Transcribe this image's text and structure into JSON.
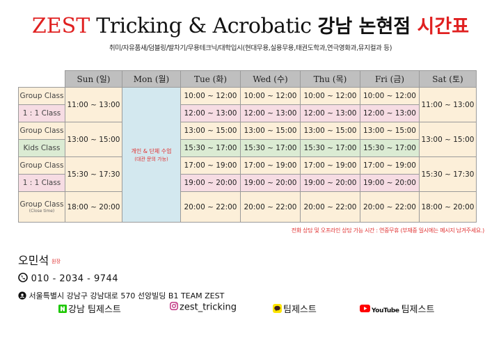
{
  "title": {
    "zest": "ZEST",
    "middle": " Tricking & Acrobatic ",
    "korean": "강남 논현점 ",
    "timetable": "시간표"
  },
  "subtitle": "취미/자유품새/덤블링/발차기/무용테크닉/대학입시(현대무용,실용무용,태권도학과,연극영화과,뮤지컬과 등)",
  "days": [
    "Sun (일)",
    "Mon (월)",
    "Tue (화)",
    "Wed (수)",
    "Thu (목)",
    "Fri (금)",
    "Sat (토)"
  ],
  "labels": {
    "group1": "Group Class",
    "one1": "1 : 1  Class",
    "group2": "Group Class",
    "kids": "Kids   Class",
    "group3": "Group Class",
    "one3": "1 : 1  Class",
    "group4": "Group Class",
    "group4_note": "(Close time)"
  },
  "sun": {
    "b1": "11:00 ~ 13:00",
    "b2": "13:00 ~ 15:00",
    "b3": "15:30 ~ 17:30",
    "b4": "18:00 ~ 20:00"
  },
  "sat": {
    "b1": "11:00 ~ 13:00",
    "b2": "13:00 ~ 15:00",
    "b3": "15:30 ~ 17:30",
    "b4": "18:00 ~ 20:00"
  },
  "mon": {
    "line1": "개인 & 단체 수업",
    "line2": "(대관 문의 가능)"
  },
  "weekday": {
    "r1": "10:00 ~ 12:00",
    "r2": "12:00 ~ 13:00",
    "r3": "13:00 ~ 15:00",
    "r4": "15:30 ~ 17:00",
    "r5": "17:00 ~ 19:00",
    "r6": "19:00 ~ 20:00",
    "r7": "20:00 ~ 22:00"
  },
  "notice": "전화 상담 및 오프라인 상담 가능 시간 : 연중무휴 (부재중 일시에는 메시지 남겨주세요.)",
  "contact": {
    "name": "오민석",
    "role": "원장",
    "phone": "010 - 2034 - 9744",
    "address": "서울특별시 강남구 강남대로 570 선앙빌딩 B1 TEAM ZEST"
  },
  "social": {
    "naver": "강남 팀제스트",
    "instagram": "zest_tricking",
    "kakao": "팀제스트",
    "youtube_logo": "YouTube",
    "youtube": "팀제스트"
  },
  "colors": {
    "accent_red": "#e02020",
    "peach": "#fcefd9",
    "pink": "#f6dce3",
    "green": "#dbebd3",
    "blue": "#d3e8ef",
    "header_gray": "#bfbfbf"
  }
}
